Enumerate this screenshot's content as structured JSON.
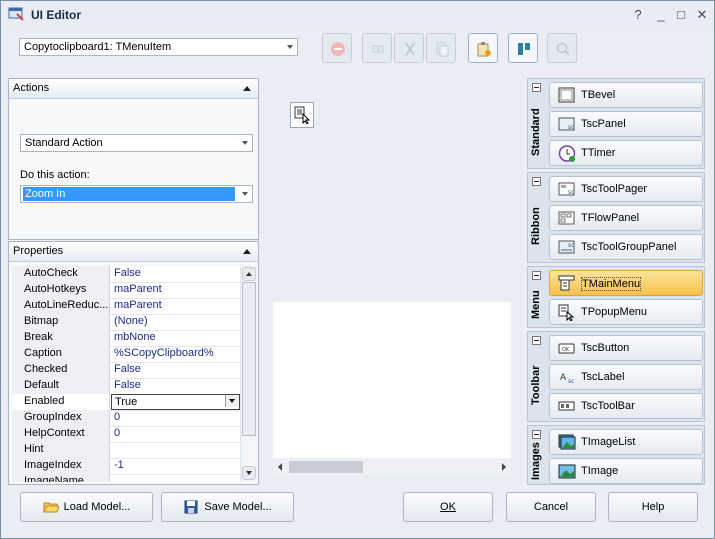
{
  "window": {
    "title": "UI Editor",
    "controls": [
      "?",
      "_",
      "□",
      "✕"
    ]
  },
  "component_select": {
    "value": "Copytoclipboard1: TMenuItem"
  },
  "actions_panel": {
    "header": "Actions",
    "action_select": "Standard Action",
    "do_label": "Do this action:",
    "do_select": "Zoom In"
  },
  "properties_panel": {
    "header": "Properties",
    "rows": [
      {
        "name": "AutoCheck",
        "value": "False"
      },
      {
        "name": "AutoHotkeys",
        "value": "maParent"
      },
      {
        "name": "AutoLineReduc...",
        "value": "maParent"
      },
      {
        "name": "Bitmap",
        "value": "(None)"
      },
      {
        "name": "Break",
        "value": "mbNone"
      },
      {
        "name": "Caption",
        "value": "%SCopyClipboard%"
      },
      {
        "name": "Checked",
        "value": "False"
      },
      {
        "name": "Default",
        "value": "False"
      },
      {
        "name": "Enabled",
        "value": "True"
      },
      {
        "name": "GroupIndex",
        "value": "0"
      },
      {
        "name": "HelpContext",
        "value": "0"
      },
      {
        "name": "Hint",
        "value": ""
      },
      {
        "name": "ImageIndex",
        "value": "-1"
      },
      {
        "name": "ImageName",
        "value": ""
      }
    ]
  },
  "palette": {
    "groups": [
      {
        "name": "Standard",
        "items": [
          "TBevel",
          "TscPanel",
          "TTimer"
        ]
      },
      {
        "name": "Ribbon",
        "items": [
          "TscToolPager",
          "TFlowPanel",
          "TscToolGroupPanel"
        ]
      },
      {
        "name": "Menu",
        "items": [
          "TMainMenu",
          "TPopupMenu"
        ]
      },
      {
        "name": "Toolbar",
        "items": [
          "TscButton",
          "TscLabel",
          "TscToolBar"
        ]
      },
      {
        "name": "Images",
        "items": [
          "TImageList",
          "TImage"
        ]
      }
    ]
  },
  "buttons": {
    "load": "Load Model...",
    "save": "Save Model...",
    "ok": "OK",
    "cancel": "Cancel",
    "help": "Help"
  },
  "colors": {
    "highlight": "#f6c24b",
    "selection": "#3399ff"
  }
}
